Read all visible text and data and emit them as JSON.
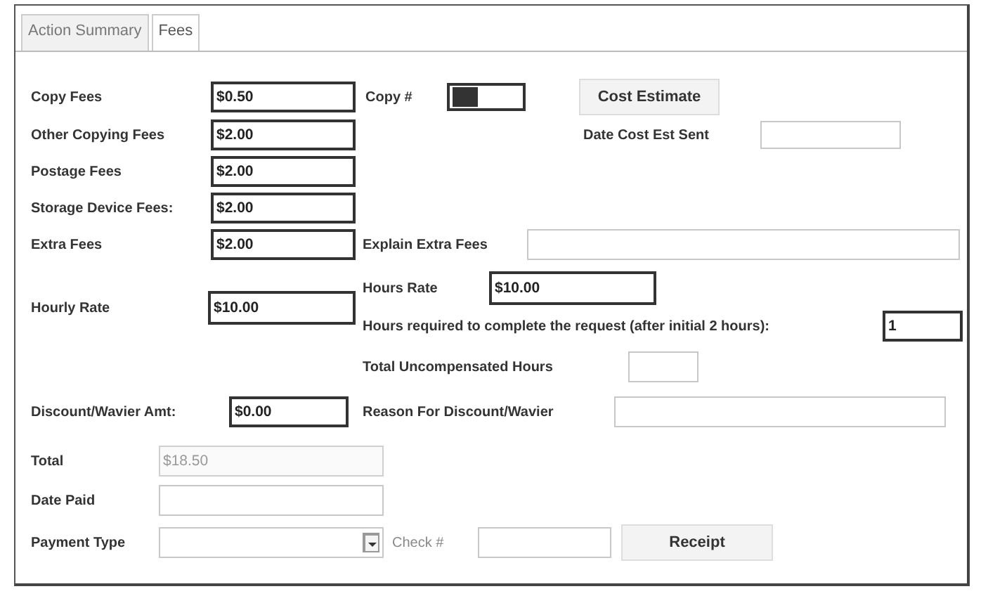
{
  "tabs": [
    {
      "label": "Action Summary",
      "selected": false
    },
    {
      "label": "Fees",
      "selected": true
    }
  ],
  "copy_fees": {
    "label": "Copy Fees",
    "value": "$0.50"
  },
  "copy_number": {
    "label": "Copy #",
    "highlighted": true
  },
  "cost_estimate_button": "Cost Estimate",
  "other_copying_fees": {
    "label": "Other Copying Fees",
    "value": "$2.00"
  },
  "date_cost_est_sent": {
    "label": "Date Cost Est Sent"
  },
  "postage_fees": {
    "label": "Postage Fees",
    "value": "$2.00"
  },
  "storage_device_fees": {
    "label": "Storage Device Fees:",
    "value": "$2.00"
  },
  "extra_fees": {
    "label": "Extra Fees",
    "value": "$2.00"
  },
  "explain_extra_fees": {
    "label": "Explain Extra Fees"
  },
  "hours_rate": {
    "label": "Hours Rate",
    "value": "$10.00"
  },
  "hourly_rate": {
    "label": "Hourly Rate",
    "value": "$10.00"
  },
  "hours_required": {
    "label": "Hours required to complete the request (after initial 2 hours):",
    "value": "1"
  },
  "total_uncompensated_hours": {
    "label": "Total Uncompensated Hours"
  },
  "discount_wavier_amt": {
    "label": "Discount/Wavier Amt:",
    "value": "$0.00"
  },
  "reason_for_discount": {
    "label": "Reason For Discount/Wavier"
  },
  "total": {
    "label": "Total",
    "value": "$18.50",
    "disabled": true
  },
  "date_paid": {
    "label": "Date Paid"
  },
  "payment_type": {
    "label": "Payment Type"
  },
  "check_number": {
    "label": "Check #"
  },
  "receipt_button": "Receipt"
}
